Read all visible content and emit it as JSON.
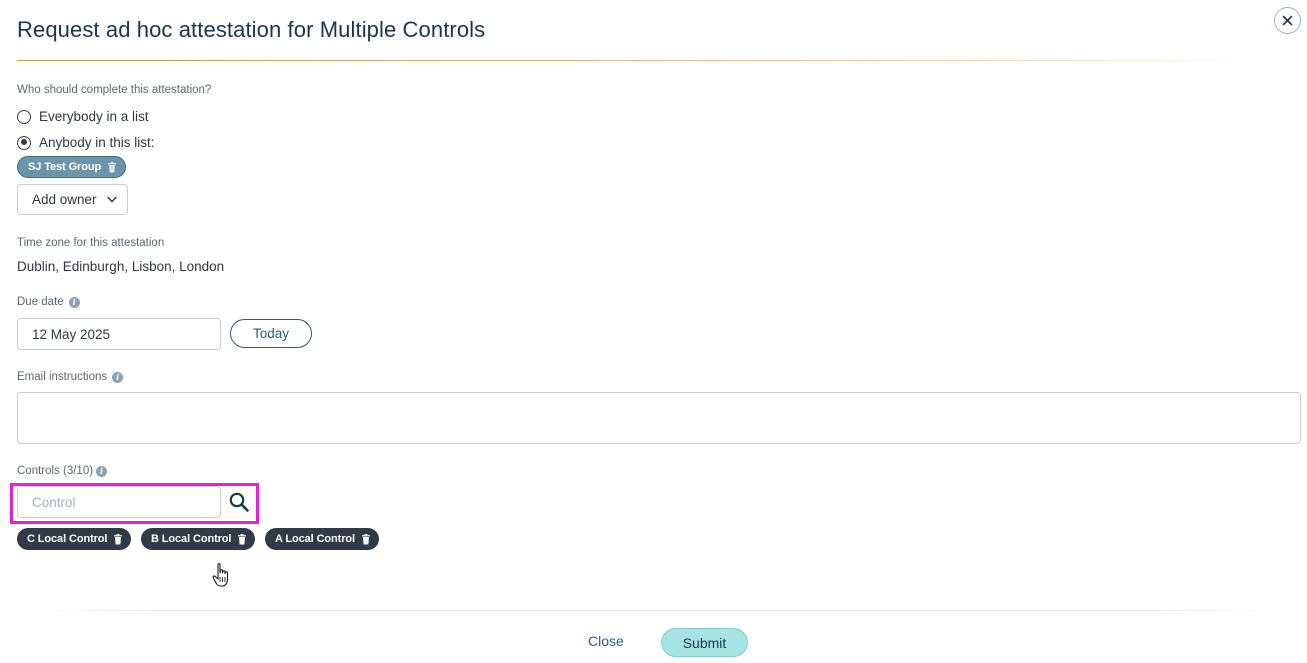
{
  "dialog": {
    "title": "Request ad hoc attestation for Multiple Controls"
  },
  "assignees": {
    "question": "Who should complete this attestation?",
    "options": [
      {
        "label": "Everybody in a list",
        "checked": false
      },
      {
        "label": "Anybody in this list:",
        "checked": true
      }
    ],
    "selected_group": "SJ Test Group",
    "add_owner_label": "Add owner"
  },
  "timezone": {
    "label": "Time zone for this attestation",
    "value": "Dublin, Edinburgh, Lisbon, London"
  },
  "due_date": {
    "label": "Due date",
    "value": "12 May 2025",
    "today_label": "Today"
  },
  "email": {
    "label": "Email instructions",
    "value": ""
  },
  "controls": {
    "label": "Controls (3/10)",
    "placeholder": "Control",
    "items": [
      "C Local Control",
      "B Local Control",
      "A Local Control"
    ]
  },
  "footer": {
    "close_label": "Close",
    "submit_label": "Submit"
  },
  "colors": {
    "title": "#16374f",
    "accent_rule": "#c49a4a",
    "group_chip": "#6b95ad",
    "control_chip": "#2f3b47",
    "submit_bg": "#a8e3e3",
    "highlight": "#e81fd4"
  },
  "icons": {
    "close": "close-icon",
    "info": "info-icon",
    "trash": "trash-icon",
    "chevron": "chevron-down-icon",
    "search": "search-icon",
    "cursor": "hand-cursor-icon"
  }
}
